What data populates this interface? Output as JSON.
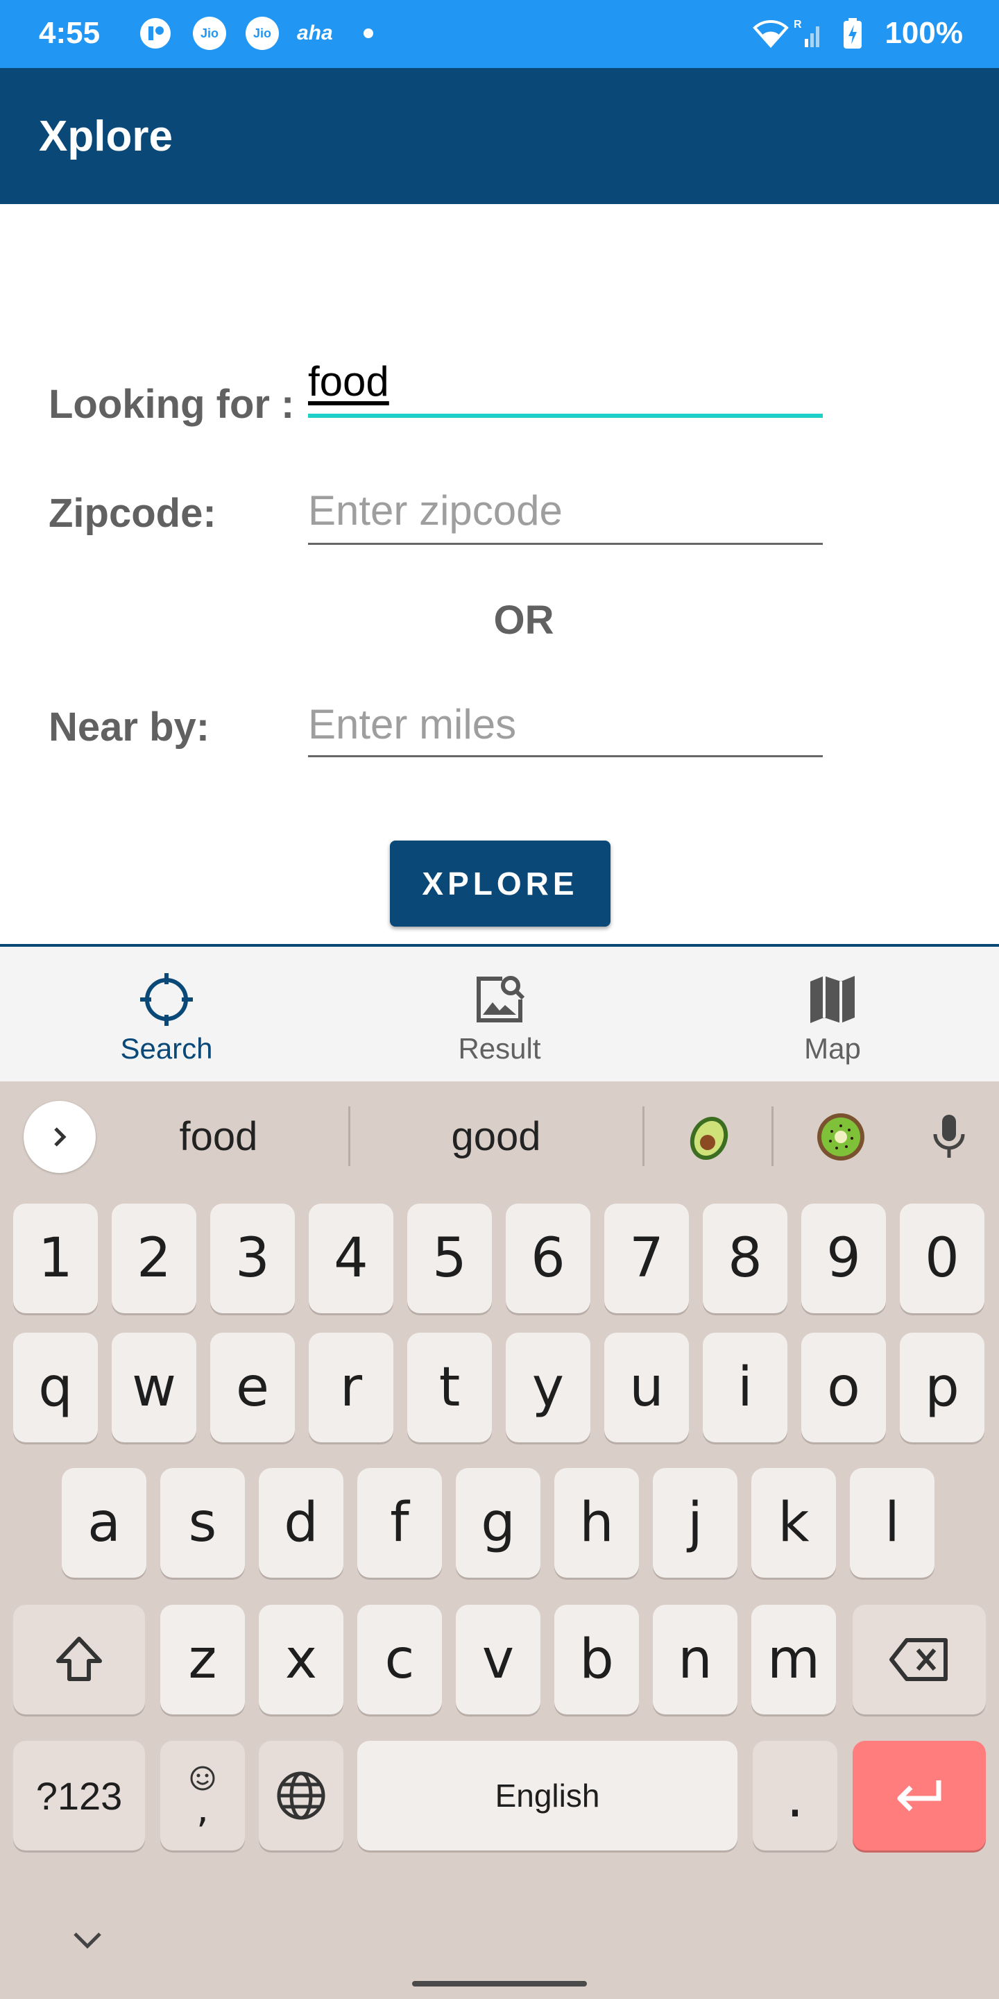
{
  "status_bar": {
    "time": "4:55",
    "badges": [
      "Jio",
      "Jio"
    ],
    "aha_text": "aha",
    "battery_percent": "100%",
    "background": "#2196f3"
  },
  "app_bar": {
    "title": "Xplore",
    "background": "#0a4878"
  },
  "form": {
    "looking_for": {
      "label": "Looking for :",
      "value": "food"
    },
    "zipcode": {
      "label": "Zipcode:",
      "placeholder": "Enter zipcode"
    },
    "or_text": "OR",
    "near_by": {
      "label": "Near by:",
      "placeholder": "Enter miles"
    },
    "submit_label": "XPLORE",
    "accent": "#1ed0c8"
  },
  "bottom_nav": {
    "items": [
      {
        "label": "Search",
        "icon": "crosshair-icon",
        "active": true
      },
      {
        "label": "Result",
        "icon": "image-search-icon",
        "active": false
      },
      {
        "label": "Map",
        "icon": "map-icon",
        "active": false
      }
    ]
  },
  "keyboard": {
    "suggestions": [
      "food",
      "good"
    ],
    "emoji_suggestions": [
      "avocado-emoji",
      "kiwi-emoji"
    ],
    "row_numbers": [
      "1",
      "2",
      "3",
      "4",
      "5",
      "6",
      "7",
      "8",
      "9",
      "0"
    ],
    "row_top": [
      "q",
      "w",
      "e",
      "r",
      "t",
      "y",
      "u",
      "i",
      "o",
      "p"
    ],
    "row_middle": [
      "a",
      "s",
      "d",
      "f",
      "g",
      "h",
      "j",
      "k",
      "l"
    ],
    "row_bottom": [
      "z",
      "x",
      "c",
      "v",
      "b",
      "n",
      "m"
    ],
    "symbols_label": "?123",
    "comma_label": ",",
    "space_label": "English",
    "period_label": ".",
    "enter_color": "#ff7d7d"
  }
}
